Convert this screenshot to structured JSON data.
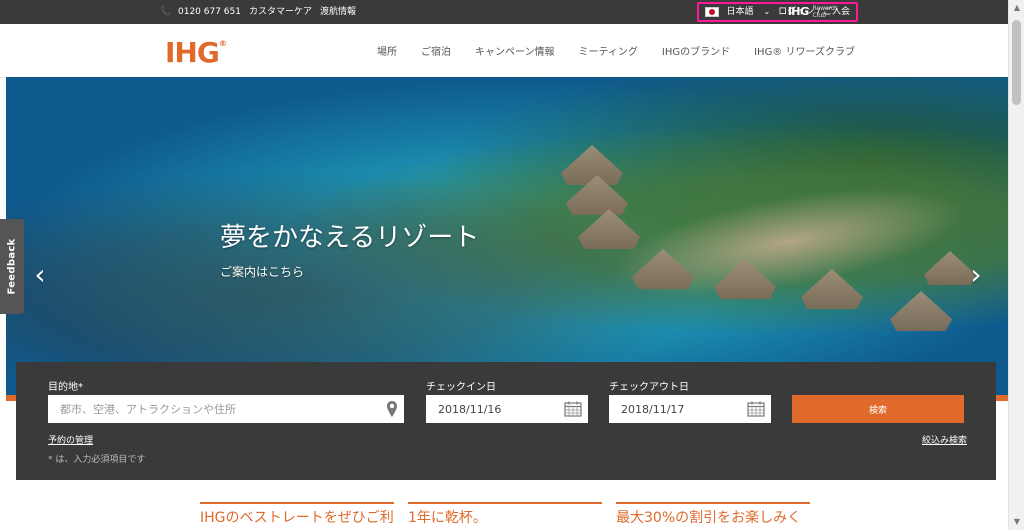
{
  "topbar": {
    "phone": "0120 677 651",
    "customer_care": "カスタマーケア",
    "travel_info": "渡航情報",
    "language": "日本語",
    "login": "ログイン / ご入会",
    "rewards_brand": "IHG",
    "rewards_line1": "Rewards",
    "rewards_line2": "Club"
  },
  "header": {
    "logo": "IHG",
    "logo_mark": "®",
    "nav": [
      {
        "label": "場所"
      },
      {
        "label": "ご宿泊"
      },
      {
        "label": "キャンペーン情報"
      },
      {
        "label": "ミーティング"
      },
      {
        "label": "IHGのブランド"
      },
      {
        "label": "IHG® リワーズクラブ"
      }
    ]
  },
  "hero": {
    "title": "夢をかなえるリゾート",
    "subtitle": "ご案内はこちら",
    "arrow_left": "‹",
    "arrow_right": "›"
  },
  "feedback": {
    "label": "Feedback"
  },
  "booking": {
    "destination_label": "目的地*",
    "destination_placeholder": "都市、空港、アトラクションや住所",
    "checkin_label": "チェックイン日",
    "checkin_value": "2018/11/16",
    "checkout_label": "チェックアウト日",
    "checkout_value": "2018/11/17",
    "search_label": "検索",
    "manage_reservation": "予約の管理",
    "advanced_search": "絞込み検索",
    "required_note": "* は、入力必須項目です"
  },
  "promos": [
    {
      "text": "IHGのベストレートをぜひご利"
    },
    {
      "text": "1年に乾杯。"
    },
    {
      "text": "最大30%の割引をお楽しみく"
    }
  ],
  "colors": {
    "accent": "#e06a2c",
    "topbar": "#3a3a3a",
    "highlight": "#ff1a9b"
  },
  "icons": {
    "phone": "phone-icon",
    "flag": "japan-flag-icon",
    "pin": "map-pin-icon",
    "calendar": "calendar-icon"
  }
}
